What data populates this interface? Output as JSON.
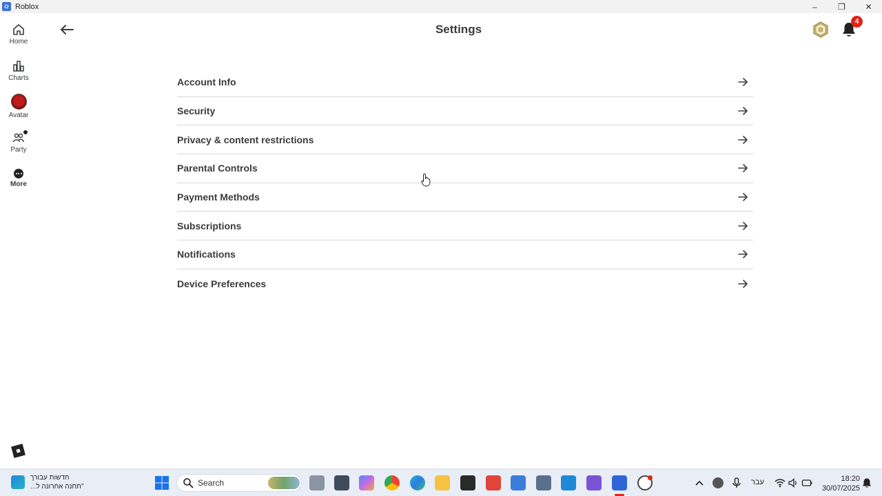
{
  "window": {
    "title": "Roblox"
  },
  "rail": {
    "items": [
      {
        "label": "Home"
      },
      {
        "label": "Charts"
      },
      {
        "label": "Avatar"
      },
      {
        "label": "Party"
      },
      {
        "label": "More"
      }
    ]
  },
  "header": {
    "title": "Settings",
    "notification_count": "4"
  },
  "settings": {
    "items": [
      {
        "label": "Account Info"
      },
      {
        "label": "Security"
      },
      {
        "label": "Privacy & content restrictions"
      },
      {
        "label": "Parental Controls"
      },
      {
        "label": "Payment Methods"
      },
      {
        "label": "Subscriptions"
      },
      {
        "label": "Notifications"
      },
      {
        "label": "Device Preferences"
      }
    ]
  },
  "taskbar": {
    "news_title": "חדשות עבורך",
    "news_subtitle": "\"תחנה אחרונה ל...",
    "search_placeholder": "Search",
    "language": "עבר",
    "time": "18:20",
    "date": "30/07/2025"
  },
  "colors": {
    "accent_red": "#e2231a",
    "text": "#393b3d",
    "divider": "#d7d7d7"
  }
}
